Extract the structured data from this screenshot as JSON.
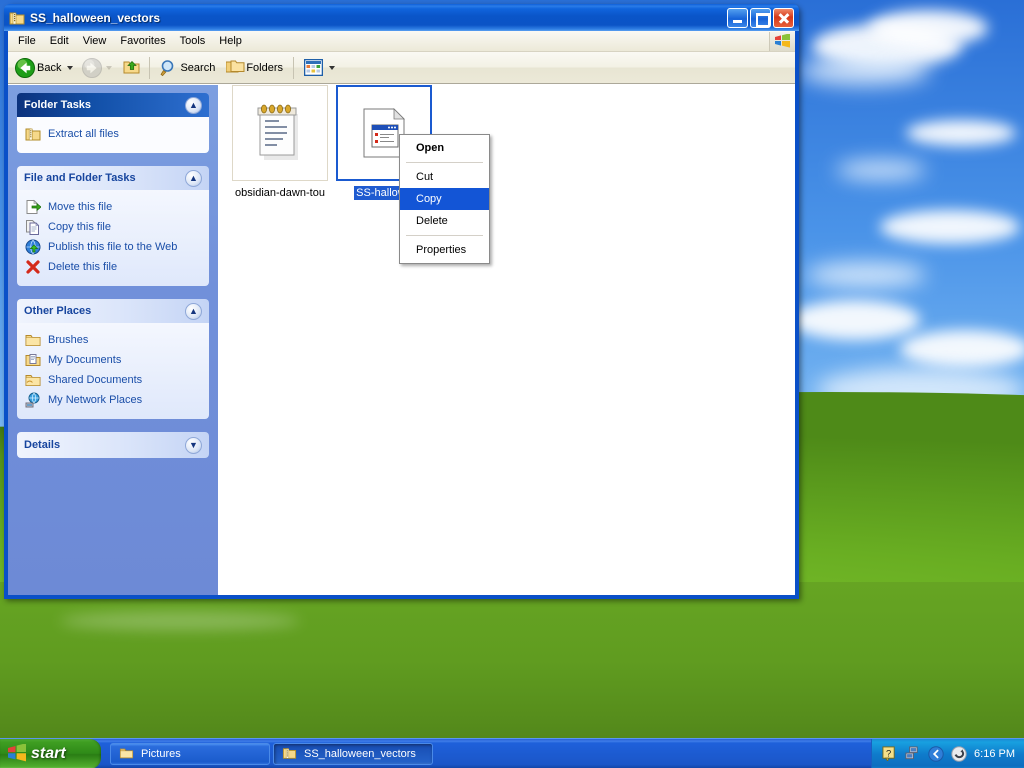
{
  "window": {
    "title": "SS_halloween_vectors",
    "title_icon": "zip-folder-icon",
    "buttons": {
      "minimize": "minimize-button",
      "maximize": "maximize-button",
      "close": "close-button"
    }
  },
  "menubar": {
    "items": [
      {
        "label": "File"
      },
      {
        "label": "Edit"
      },
      {
        "label": "View"
      },
      {
        "label": "Favorites"
      },
      {
        "label": "Tools"
      },
      {
        "label": "Help"
      }
    ],
    "brand_icon": "windows-flag-icon"
  },
  "toolbar": {
    "back": {
      "label": "Back",
      "icon": "back-arrow-icon",
      "enabled": true
    },
    "forward": {
      "label": "",
      "icon": "forward-arrow-icon",
      "enabled": false
    },
    "up": {
      "label": "",
      "icon": "up-folder-icon"
    },
    "search": {
      "label": "Search",
      "icon": "search-icon"
    },
    "folders": {
      "label": "Folders",
      "icon": "folders-icon"
    },
    "views": {
      "label": "",
      "icon": "views-icon"
    }
  },
  "sidebar": {
    "panels": [
      {
        "title": "Folder Tasks",
        "style": "dark",
        "chevron": "chevron-up-icon",
        "collapsed": false,
        "items": [
          {
            "label": "Extract all files",
            "icon": "zip-folder-icon"
          }
        ]
      },
      {
        "title": "File and Folder Tasks",
        "style": "light",
        "chevron": "chevron-up-icon",
        "collapsed": false,
        "items": [
          {
            "label": "Move this file",
            "icon": "move-file-icon"
          },
          {
            "label": "Copy this file",
            "icon": "copy-file-icon"
          },
          {
            "label": "Publish this file to the Web",
            "icon": "publish-web-icon"
          },
          {
            "label": "Delete this file",
            "icon": "delete-x-icon"
          }
        ]
      },
      {
        "title": "Other Places",
        "style": "light",
        "chevron": "chevron-up-icon",
        "collapsed": false,
        "items": [
          {
            "label": "Brushes",
            "icon": "folder-icon"
          },
          {
            "label": "My Documents",
            "icon": "my-documents-icon"
          },
          {
            "label": "Shared Documents",
            "icon": "shared-folder-icon"
          },
          {
            "label": "My Network Places",
            "icon": "network-places-icon"
          }
        ]
      },
      {
        "title": "Details",
        "style": "light",
        "chevron": "chevron-down-icon",
        "collapsed": true,
        "items": []
      }
    ]
  },
  "files": [
    {
      "name": "obsidian-dawn-tou",
      "icon": "notepad-document-icon",
      "selected": false
    },
    {
      "name": "SS-hallowe",
      "icon": "html-document-icon",
      "selected": true
    }
  ],
  "context_menu": {
    "items": [
      {
        "label": "Open",
        "bold": true,
        "highlighted": false
      },
      {
        "separator": true
      },
      {
        "label": "Cut",
        "bold": false,
        "highlighted": false
      },
      {
        "label": "Copy",
        "bold": false,
        "highlighted": true
      },
      {
        "label": "Delete",
        "bold": false,
        "highlighted": false
      },
      {
        "separator": true
      },
      {
        "label": "Properties",
        "bold": false,
        "highlighted": false
      }
    ]
  },
  "taskbar": {
    "start_label": "start",
    "start_icon": "windows-flag-icon",
    "buttons": [
      {
        "label": "Pictures",
        "icon": "folder-icon",
        "active": false
      },
      {
        "label": "SS_halloween_vectors",
        "icon": "zip-folder-icon",
        "active": true
      }
    ],
    "tray": {
      "icons": [
        "help-balloon-icon",
        "network-connection-icon",
        "show-hidden-icons-icon",
        "security-shield-icon"
      ],
      "time": "6:16 PM"
    }
  },
  "colors": {
    "titlebar_blue": "#0a55c8",
    "sidebar_blue": "#7190da",
    "selection_blue": "#1f5bd0",
    "menu_highlight": "#1355d6",
    "taskbar_blue": "#1b56c8",
    "start_green": "#2f8a18"
  }
}
